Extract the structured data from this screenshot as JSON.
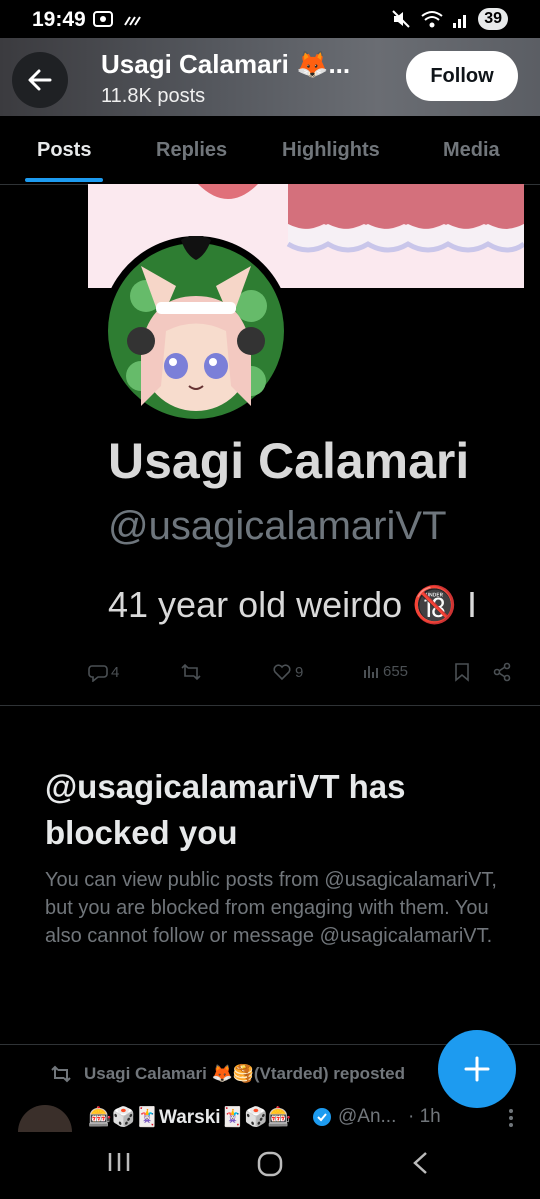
{
  "status_bar": {
    "time": "19:49",
    "battery": "39"
  },
  "header": {
    "title": "Usagi Calamari 🦊...",
    "subtitle": "11.8K posts",
    "follow_label": "Follow"
  },
  "tabs": [
    {
      "label": "Posts",
      "active": true
    },
    {
      "label": "Replies",
      "active": false
    },
    {
      "label": "Highlights",
      "active": false
    },
    {
      "label": "Media",
      "active": false
    }
  ],
  "embedded_profile": {
    "name": "Usagi Calamari",
    "handle": "@usagicalamariVT",
    "bio": "41 year old weirdo 🔞 I"
  },
  "post_actions": {
    "replies": "4",
    "likes": "9",
    "views": "655"
  },
  "blocked": {
    "title": "@usagicalamariVT has blocked you",
    "message": "You can view public posts from @usagicalamariVT, but you are blocked from engaging with them. You also cannot follow or message @usagicalamariVT."
  },
  "repost": {
    "label": "Usagi Calamari 🦊🥞(Vtarded) reposted"
  },
  "next_post": {
    "author": "🎰🎲🃏Warski🃏🎲🎰",
    "handle": "@An...",
    "time": "· 1h"
  },
  "colors": {
    "accent": "#1d9bf0",
    "background": "#000000",
    "muted_text": "#71767b"
  }
}
